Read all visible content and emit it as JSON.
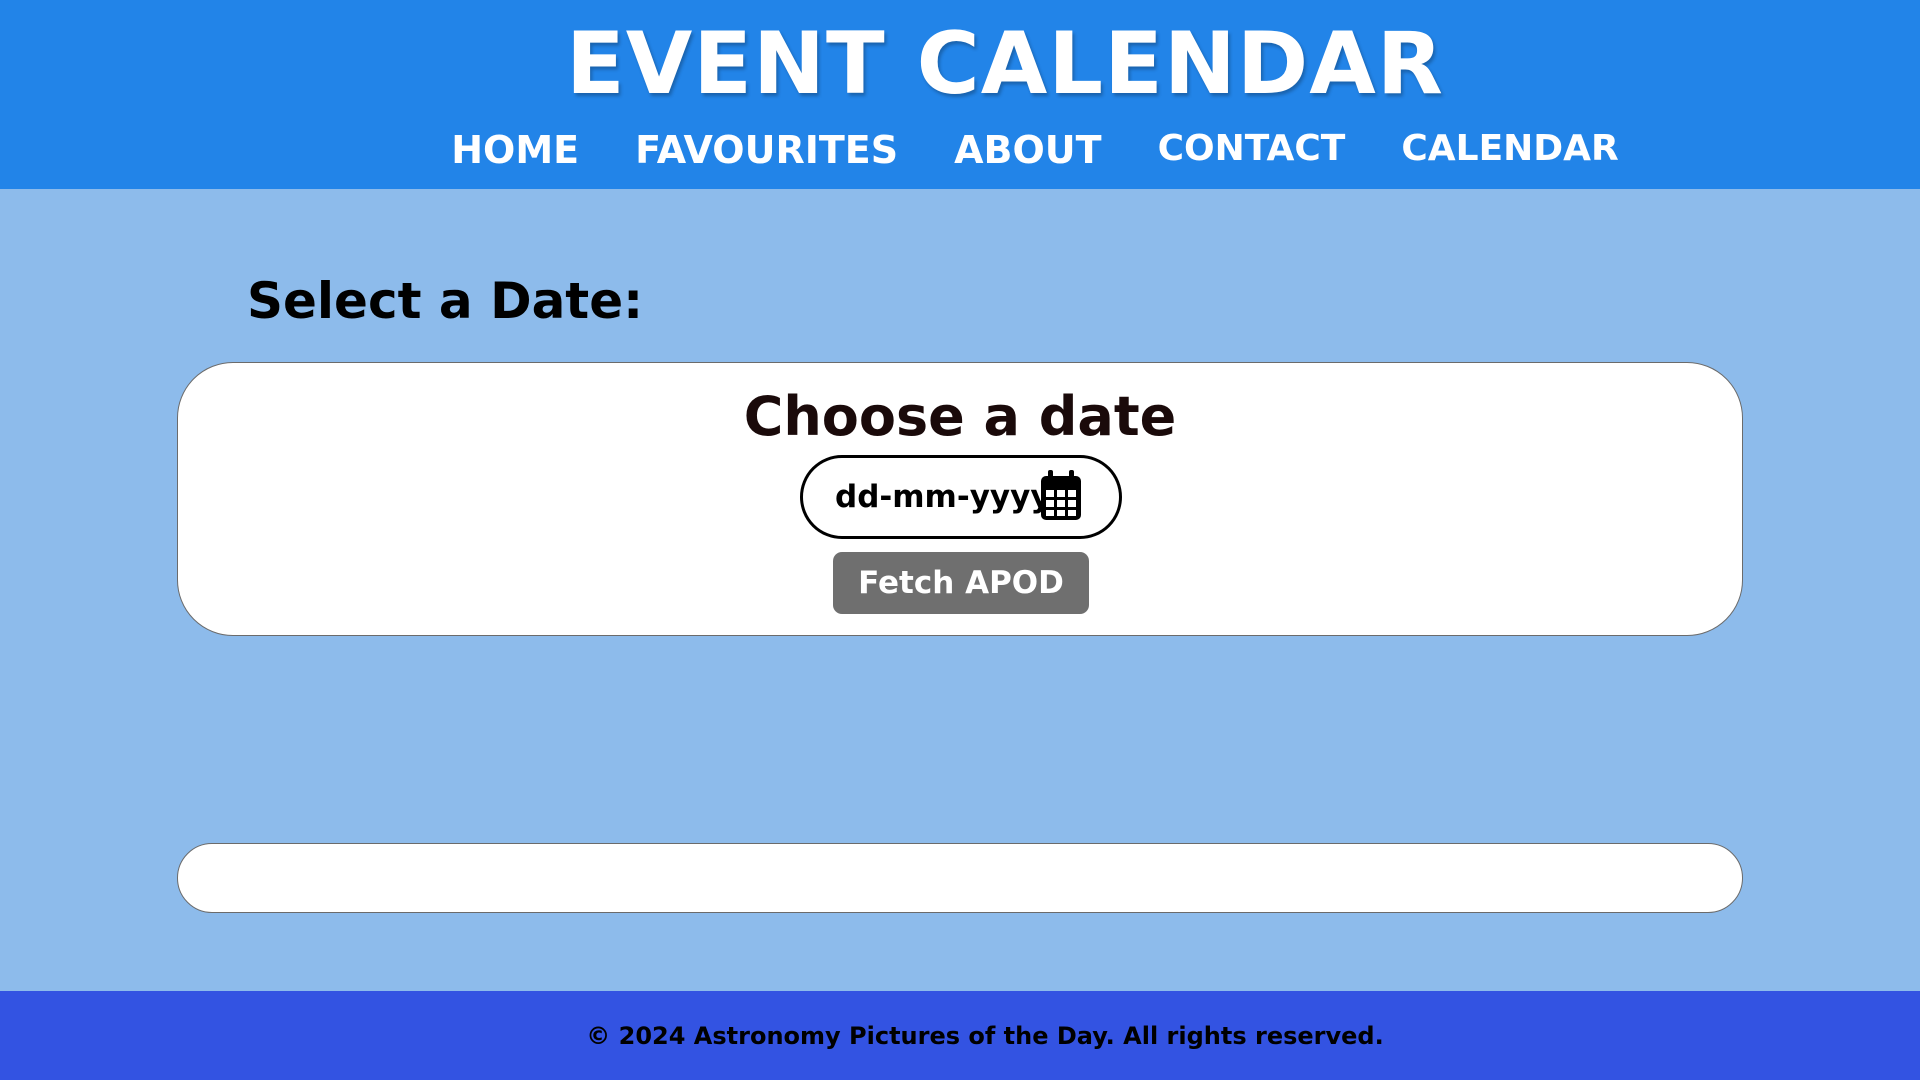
{
  "header": {
    "title": "EVENT CALENDAR",
    "nav": [
      "HOME",
      "FAVOURITES",
      "ABOUT",
      "CONTACT",
      "CALENDAR"
    ]
  },
  "main": {
    "heading": "Select a Date:",
    "card": {
      "title": "Choose a date",
      "date_placeholder": "dd-mm-yyyy",
      "calendar_icon": "calendar-icon",
      "button_label": "Fetch APOD"
    }
  },
  "footer": {
    "text": "© 2024 Astronomy Pictures of the Day. All rights reserved."
  },
  "colors": {
    "header_bg": "#2284e8",
    "page_bg": "#8dbbeb",
    "footer_bg": "#3353e2",
    "button_bg": "#6f6f6f"
  }
}
